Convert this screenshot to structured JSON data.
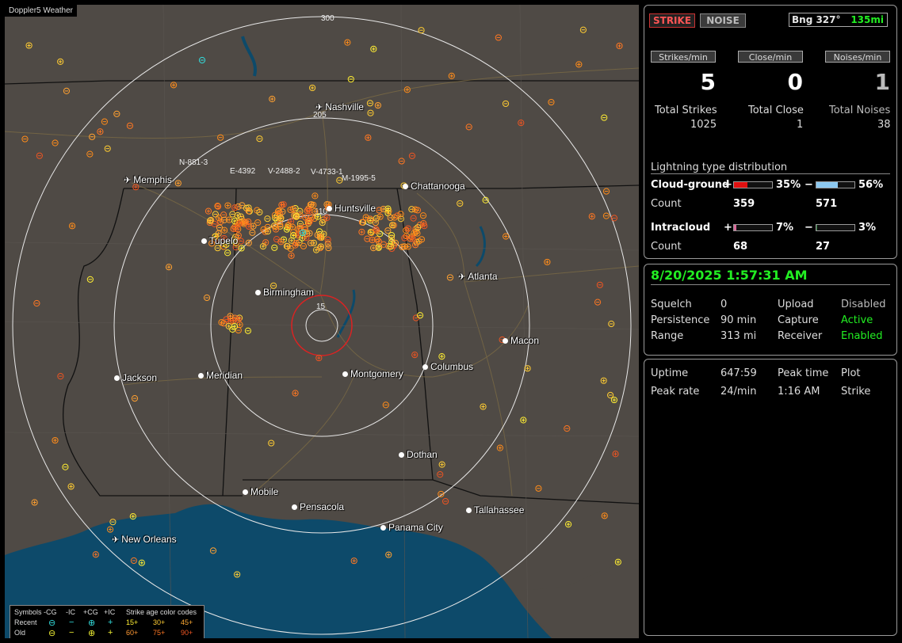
{
  "app": {
    "title": "Doppler5 Weather"
  },
  "map": {
    "range_labels": [
      "300",
      "205",
      "110",
      "15"
    ],
    "cities": [
      {
        "name": "Nashville",
        "airport": true
      },
      {
        "name": "Memphis",
        "airport": true
      },
      {
        "name": "Chattanooga",
        "airport": false
      },
      {
        "name": "Huntsville",
        "airport": false
      },
      {
        "name": "Tupelo",
        "airport": false
      },
      {
        "name": "Atlanta",
        "airport": true
      },
      {
        "name": "Birmingham",
        "airport": false
      },
      {
        "name": "Macon",
        "airport": false
      },
      {
        "name": "Jackson",
        "airport": false
      },
      {
        "name": "Meridian",
        "airport": false
      },
      {
        "name": "Montgomery",
        "airport": false
      },
      {
        "name": "Columbus",
        "airport": false
      },
      {
        "name": "Dothan",
        "airport": false
      },
      {
        "name": "Mobile",
        "airport": false
      },
      {
        "name": "Pensacola",
        "airport": false
      },
      {
        "name": "Tallahassee",
        "airport": false
      },
      {
        "name": "Panama City",
        "airport": false
      },
      {
        "name": "New Orleans",
        "airport": true
      }
    ],
    "storm_labels": [
      "N-881-3",
      "E-4392",
      "V-2488-2",
      "V-4733-1",
      "M-1995-5"
    ]
  },
  "legend": {
    "symbols_label": "Symbols",
    "col_headers": [
      "-CG",
      "-IC",
      "+CG",
      "+IC"
    ],
    "recent_label": "Recent",
    "old_label": "Old",
    "age_title": "Strike age color codes",
    "age_recent": [
      "15+",
      "30+",
      "45+"
    ],
    "age_old": [
      "60+",
      "75+",
      "90+"
    ]
  },
  "top_panel": {
    "strike_button": "STRIKE",
    "noise_button": "NOISE",
    "bearing": "Bng 327°",
    "distance": "135mi",
    "rate_headers": [
      "Strikes/min",
      "Close/min",
      "Noises/min"
    ],
    "rate_values": [
      "5",
      "0",
      "1"
    ],
    "total_labels": [
      "Total Strikes",
      "Total Close",
      "Total Noises"
    ],
    "total_values": [
      "1025",
      "1",
      "38"
    ],
    "distribution_title": "Lightning type distribution",
    "cg_label": "Cloud-ground",
    "ic_label": "Intracloud",
    "count_label": "Count",
    "plus_sign": "+",
    "minus_sign": "−",
    "cg_pos_pct": "35%",
    "cg_neg_pct": "56%",
    "cg_pos_count": "359",
    "cg_neg_count": "571",
    "ic_pos_pct": "7%",
    "ic_neg_pct": "3%",
    "ic_pos_count": "68",
    "ic_neg_count": "27",
    "bars": {
      "cg_pos": 0.35,
      "cg_neg": 0.56,
      "ic_pos": 0.07,
      "ic_neg": 0.03
    }
  },
  "status_panel": {
    "datetime": "8/20/2025 1:57:31 AM",
    "rows": [
      {
        "k1": "Squelch",
        "v1": "0",
        "k2": "Upload",
        "v2": "Disabled"
      },
      {
        "k1": "Persistence",
        "v1": "90 min",
        "k2": "Capture",
        "v2": "Active"
      },
      {
        "k1": "Range",
        "v1": "313 mi",
        "k2": "Receiver",
        "v2": "Enabled"
      }
    ]
  },
  "stats_panel": {
    "uptime_label": "Uptime",
    "uptime_value": "647:59",
    "peak_time_label": "Peak time",
    "plot_label": "Plot",
    "peak_rate_label": "Peak rate",
    "peak_rate_value": "24/min",
    "peak_time_value": "1:16 AM",
    "plot_value": "Strike"
  },
  "colors": {
    "land": "#4f4a45",
    "water": "#0d4a6a",
    "ring": "#e8e8e8",
    "close_ring": "#dd2222",
    "strike_orange": "#ff8c1a",
    "strike_yellow": "#ffee33",
    "accent_green": "#22ee22",
    "bar_red": "#e01010",
    "bar_blue": "#8cc8f0",
    "bar_pink": "#d86a9a",
    "bar_green": "#2a7a3a"
  }
}
